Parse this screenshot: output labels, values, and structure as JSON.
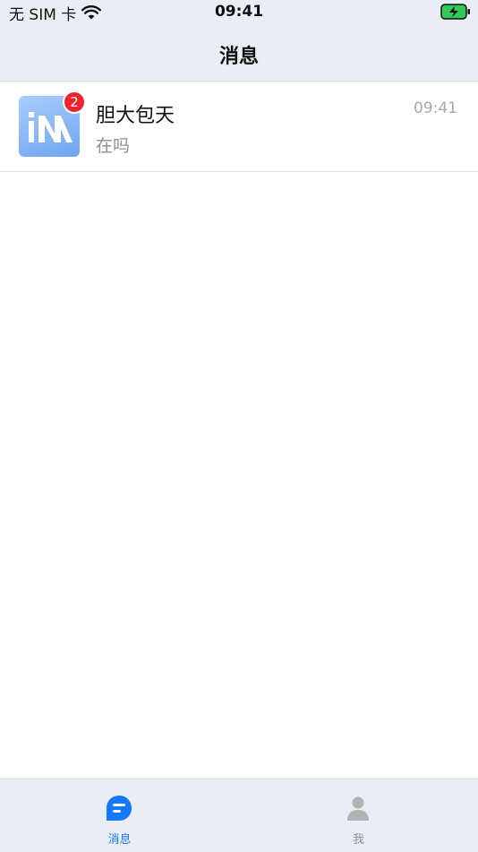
{
  "status_bar": {
    "carrier": "无 SIM 卡",
    "time": "09:41",
    "wifi_icon": "wifi-icon",
    "battery_icon": "battery-charging-icon"
  },
  "nav": {
    "title": "消息"
  },
  "conversations": [
    {
      "name": "胆大包天",
      "preview": "在吗",
      "time": "09:41",
      "unread": "2",
      "avatar_text": "iM"
    }
  ],
  "tabs": [
    {
      "label": "消息",
      "icon": "messages-icon",
      "active": true,
      "color": "#1677ff"
    },
    {
      "label": "我",
      "icon": "person-icon",
      "active": false,
      "color": "#8e8e93"
    }
  ],
  "colors": {
    "accent": "#1677ff",
    "badge": "#f2232b",
    "bar_background": "#e9eef5",
    "battery_fill": "#34c759"
  }
}
